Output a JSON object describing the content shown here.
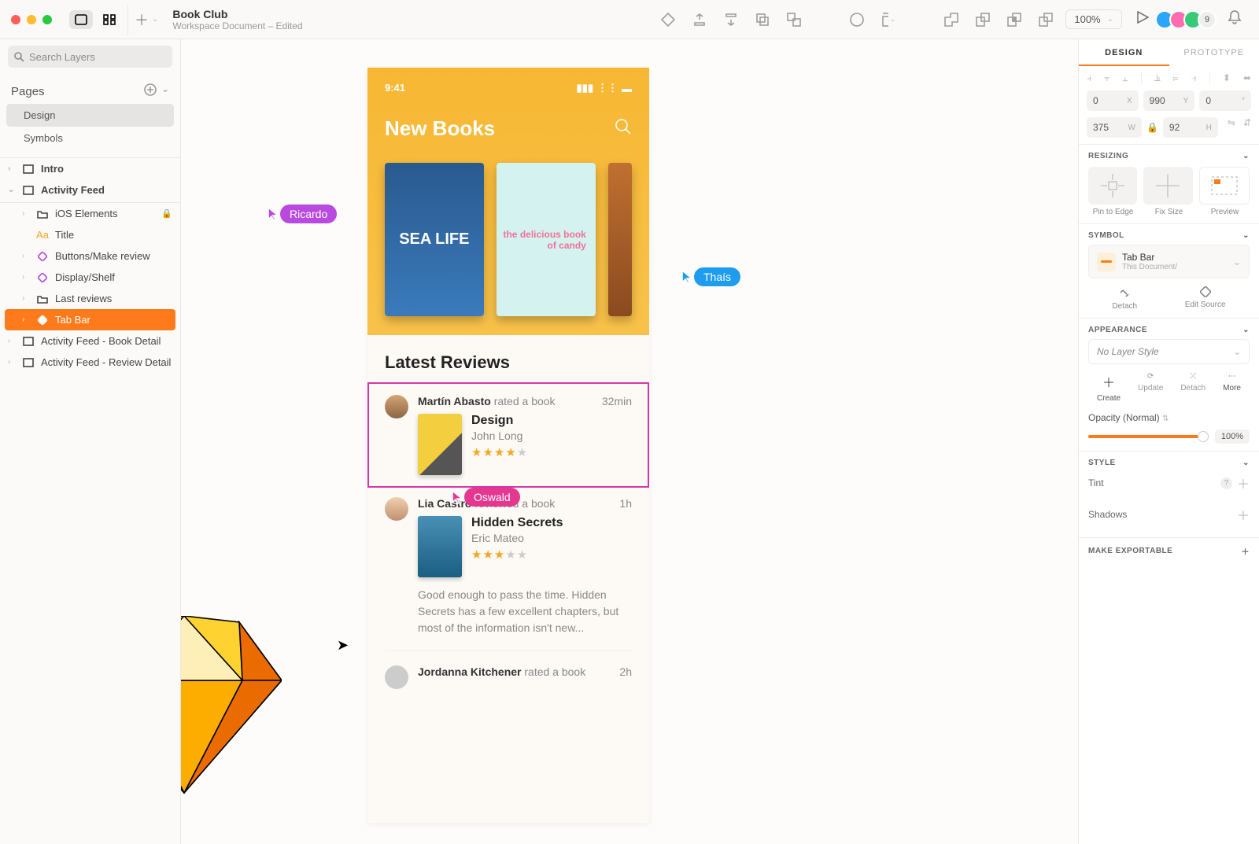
{
  "toolbar": {
    "doc_title": "Book Club",
    "doc_subtitle": "Workspace Document – Edited",
    "zoom": "100%",
    "avatar_count": "9"
  },
  "sidebar": {
    "search_placeholder": "Search Layers",
    "pages_label": "Pages",
    "pages": [
      "Design",
      "Symbols"
    ],
    "layers": {
      "intro": "Intro",
      "activity": "Activity Feed",
      "ios": "iOS Elements",
      "title": "Title",
      "btns": "Buttons/Make review",
      "shelf": "Display/Shelf",
      "last": "Last reviews",
      "tabbar": "Tab Bar",
      "detail1": "Activity Feed - Book Detail",
      "detail2": "Activity Feed - Review Detail"
    }
  },
  "artboard": {
    "time": "9:41",
    "hero_title": "New Books",
    "book1": "SEA LIFE",
    "book2": "the delicious book of candy",
    "section": "Latest Reviews",
    "reviews": [
      {
        "name": "Martín Abasto",
        "action": "rated a book",
        "time": "32min",
        "title": "Design",
        "author": "John Long"
      },
      {
        "name": "Lia Castro",
        "action": "reviewed a book",
        "time": "1h",
        "title": "Hidden Secrets",
        "author": "Eric Mateo",
        "text": "Good enough to pass the time. Hidden Secrets has a few excellent chapters, but most of the information isn't new..."
      },
      {
        "name": "Jordanna Kitchener",
        "action": "rated a book",
        "time": "2h"
      }
    ]
  },
  "cursors": {
    "c1": "Ricardo",
    "c2": "Thaís",
    "c3": "Oswald"
  },
  "inspector": {
    "tab_design": "DESIGN",
    "tab_proto": "PROTOTYPE",
    "x": "0",
    "xl": "X",
    "y": "990",
    "yl": "Y",
    "deg": "0",
    "degl": "°",
    "w": "375",
    "wl": "W",
    "h": "92",
    "hl": "H",
    "resizing": "RESIZING",
    "rb1": "Pin to Edge",
    "rb2": "Fix Size",
    "rb3": "Preview",
    "symbol": "SYMBOL",
    "sym_name": "Tab Bar",
    "sym_sub": "This Document/",
    "detach": "Detach",
    "edit_src": "Edit Source",
    "appearance": "APPEARANCE",
    "no_style": "No Layer Style",
    "create": "Create",
    "update": "Update",
    "detach2": "Detach",
    "more": "More",
    "opacity_label": "Opacity (Normal)",
    "opacity_val": "100%",
    "style": "STYLE",
    "tint": "Tint",
    "shadows": "Shadows",
    "export": "MAKE EXPORTABLE"
  }
}
